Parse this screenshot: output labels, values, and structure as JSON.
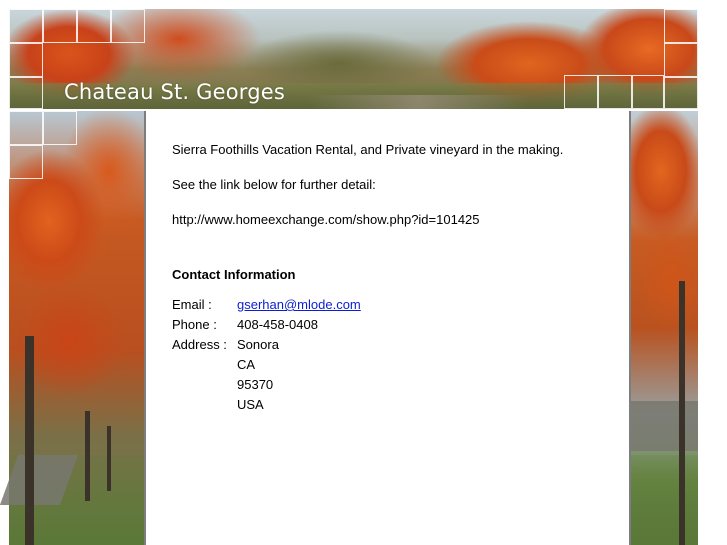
{
  "site": {
    "title": "Chateau St. Georges"
  },
  "content": {
    "description": "Sierra Foothills Vacation Rental, and Private vineyard in the making.",
    "see_link": "See the link below for further detail:",
    "url": "http://www.homeexchange.com/show.php?id=101425"
  },
  "contact": {
    "heading": "Contact Information",
    "email_label": "Email :",
    "email_value": "gserhan@mlode.com",
    "phone_label": "Phone :",
    "phone_value": "408-458-0408",
    "address_label": "Address :",
    "address_lines": [
      "Sonora",
      "CA",
      "95370",
      "USA"
    ]
  },
  "colors": {
    "link": "#0b1fd1",
    "border": "#7d7d7d",
    "foliage": "#d9541b"
  }
}
